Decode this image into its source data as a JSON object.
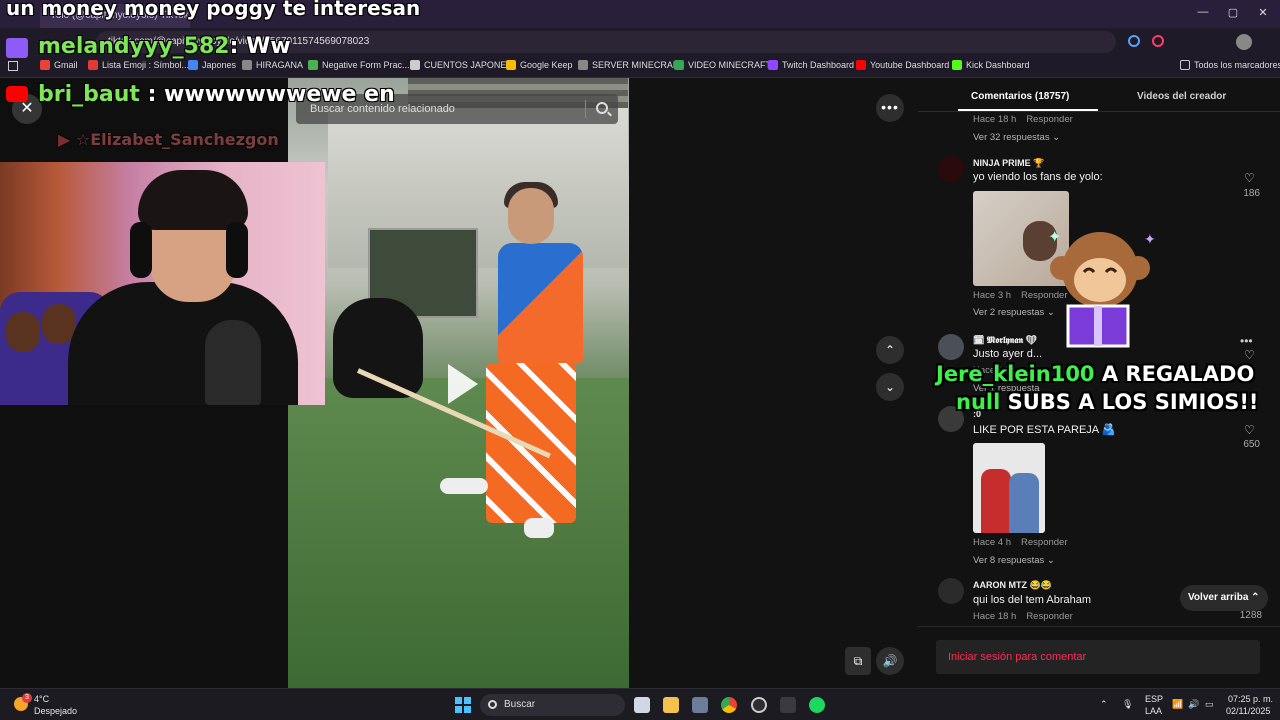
{
  "browser": {
    "tab_title": "Yolo (@capitanyoloyolo) TikTok",
    "url": "tiktok.com/@capitanyoloyolo/video/7567911574569078023",
    "window_controls": [
      "—",
      "▢",
      "✕"
    ],
    "bookmarks": [
      {
        "label": "Gmail",
        "color": "#ea4335"
      },
      {
        "label": "Lista Emoji : Símbol...",
        "color": "#e53935"
      },
      {
        "label": "Japones",
        "color": "#4285f4"
      },
      {
        "label": "HIRAGANA",
        "color": "#888888"
      },
      {
        "label": "Negative Form Prac...",
        "color": "#4caf50"
      },
      {
        "label": "CUENTOS JAPONES",
        "color": "#cccccc"
      },
      {
        "label": "Google Keep",
        "color": "#fbbc04"
      },
      {
        "label": "SERVER MINECRAFT",
        "color": "#888888"
      },
      {
        "label": "VIDEO MINECRAFT",
        "color": "#34a853"
      },
      {
        "label": "Twitch Dashboard",
        "color": "#9146ff"
      },
      {
        "label": "Youtube Dashboard",
        "color": "#ff0000"
      },
      {
        "label": "Kick Dashboard",
        "color": "#53fc18"
      }
    ],
    "all_bookmarks": "Todos los marcadores"
  },
  "stream_overlay": {
    "top_message": "un money money poggy te interesan",
    "chat": [
      {
        "user": "melandyyy_582",
        "sep": ": ",
        "text": "Ww",
        "platform": "twitch"
      },
      {
        "user": "bri_baut",
        "sep": " : ",
        "text": "wwwwwwwewe en",
        "platform": "youtube"
      },
      {
        "user": "☆Elizabet_Sanchezgon",
        "sep": "",
        "text": "",
        "platform": "youtube"
      }
    ],
    "alert": {
      "line1_user": "Jere_klein100",
      "line1_rest": " A REGALADO",
      "line2_count": "null",
      "line2_rest": " SUBS A LOS SIMIOS!!"
    }
  },
  "video": {
    "search_placeholder": "Buscar contenido relacionado",
    "close_icon": "✕",
    "more_icon": "•••",
    "up_icon": "⌃",
    "down_icon": "⌄",
    "volume_icon": "🔊",
    "pip_icon": "⧉"
  },
  "comments_panel": {
    "tab_comments": "Comentarios (18757)",
    "tab_creator": "Videos del creador",
    "items": [
      {
        "meta_time": "Hace 18 h",
        "reply": "Responder",
        "more": "Ver 32 respuestas ⌄"
      },
      {
        "user": "NINJA PRIME 🏆",
        "text": "yo viendo los fans de yolo:",
        "likes": "186",
        "meta_time": "Hace 3 h",
        "reply": "Responder",
        "more": "Ver 2 respuestas ⌄"
      },
      {
        "user": "🗓 𝕸𝖔𝖗𝖑𝖞𝖓𝖆𝖓 ❤",
        "text": "Justo ayer d...",
        "meta_time": "Hace 1 h",
        "more": "Ver 1 respuesta"
      },
      {
        "user": ":0",
        "text": "LIKE POR ESTA PAREJA 🫂",
        "likes": "650",
        "meta_time": "Hace 4 h",
        "reply": "Responder",
        "more": "Ver 8 respuestas ⌄"
      },
      {
        "user": "AARON MTZ 😂😂",
        "text": "qui los del tem Abraham",
        "likes": "1288",
        "meta_time": "Hace 18 h",
        "reply": "Responder"
      }
    ],
    "back_to_top": "Volver arriba ⌃",
    "login_prompt": "Iniciar sesión para comentar"
  },
  "taskbar": {
    "weather_temp": "4°C",
    "weather_desc": "Despejado",
    "search_label": "Buscar",
    "lang_top": "ESP",
    "lang_bottom": "LAA",
    "time": "07:25 p. m.",
    "date": "02/11/2025",
    "notification_count": "3"
  }
}
